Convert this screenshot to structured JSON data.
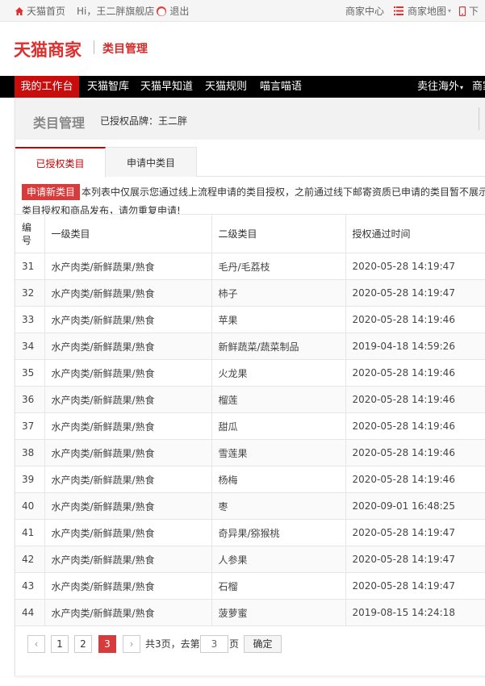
{
  "topbar": {
    "home": "天猫首页",
    "greeting": "Hi，王二胖旗舰店",
    "logout": "退出",
    "merchant_center": "商家中心",
    "merchant_map": "商家地图",
    "map_caret": "▾",
    "download": "下"
  },
  "header": {
    "brand": "天猫商家",
    "section": "类目管理"
  },
  "nav": {
    "items": [
      "我的工作台",
      "天猫智库",
      "天猫早知道",
      "天猫规则",
      "喵言喵语"
    ],
    "overseas": "卖往海外",
    "overseas_caret": "▾",
    "more": "商家"
  },
  "summary": {
    "title": "类目管理",
    "brand_label": "已授权品牌：王二胖"
  },
  "tabs": {
    "active": "已授权类目",
    "other": "申请中类目"
  },
  "notice": {
    "apply_button": "申请新类目",
    "line1": "本列表中仅展示您通过线上流程申请的类目授权，之前通过线下邮寄资质已申请的类目暂不展示",
    "line2": "类目授权和商品发布，请勿重复申请!"
  },
  "table": {
    "headers": [
      "编号",
      "一级类目",
      "二级类目",
      "授权通过时间"
    ],
    "rows": [
      [
        "31",
        "水产肉类/新鲜蔬果/熟食",
        "毛丹/毛荔枝",
        "2020-05-28 14:19:47"
      ],
      [
        "32",
        "水产肉类/新鲜蔬果/熟食",
        "柿子",
        "2020-05-28 14:19:47"
      ],
      [
        "33",
        "水产肉类/新鲜蔬果/熟食",
        "苹果",
        "2020-05-28 14:19:46"
      ],
      [
        "34",
        "水产肉类/新鲜蔬果/熟食",
        "新鲜蔬菜/蔬菜制品",
        "2019-04-18 14:59:26"
      ],
      [
        "35",
        "水产肉类/新鲜蔬果/熟食",
        "火龙果",
        "2020-05-28 14:19:46"
      ],
      [
        "36",
        "水产肉类/新鲜蔬果/熟食",
        "榴莲",
        "2020-05-28 14:19:46"
      ],
      [
        "37",
        "水产肉类/新鲜蔬果/熟食",
        "甜瓜",
        "2020-05-28 14:19:46"
      ],
      [
        "38",
        "水产肉类/新鲜蔬果/熟食",
        "雪莲果",
        "2020-05-28 14:19:46"
      ],
      [
        "39",
        "水产肉类/新鲜蔬果/熟食",
        "杨梅",
        "2020-05-28 14:19:46"
      ],
      [
        "40",
        "水产肉类/新鲜蔬果/熟食",
        "枣",
        "2020-09-01 16:48:25"
      ],
      [
        "41",
        "水产肉类/新鲜蔬果/熟食",
        "奇异果/猕猴桃",
        "2020-05-28 14:19:47"
      ],
      [
        "42",
        "水产肉类/新鲜蔬果/熟食",
        "人参果",
        "2020-05-28 14:19:47"
      ],
      [
        "43",
        "水产肉类/新鲜蔬果/熟食",
        "石榴",
        "2020-05-28 14:19:47"
      ],
      [
        "44",
        "水产肉类/新鲜蔬果/熟食",
        "菠萝蜜",
        "2019-08-15 14:24:18"
      ]
    ]
  },
  "pager": {
    "prev": "‹",
    "pages": [
      "1",
      "2",
      "3"
    ],
    "current": "3",
    "next": "›",
    "total_text": "共3页，去第",
    "input_value": "3",
    "page_suffix": "页",
    "confirm": "确定"
  },
  "colors": {
    "brand_red": "#e02d2d",
    "nav_active": "#c90d0d",
    "button_red": "#d83b3b"
  }
}
